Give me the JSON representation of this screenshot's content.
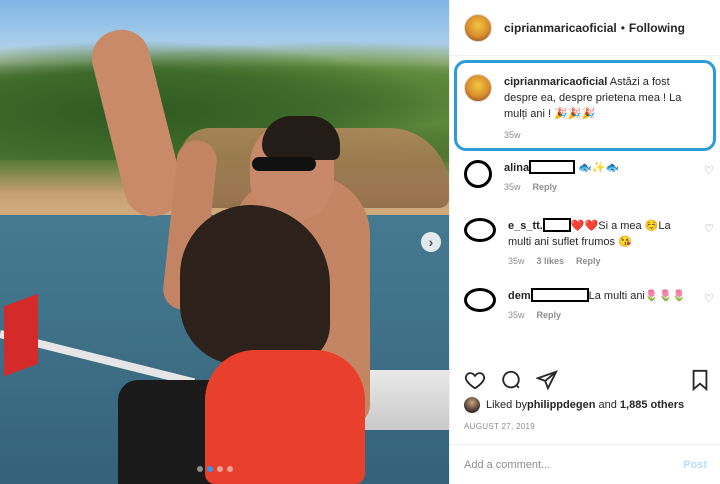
{
  "post": {
    "carousel_next": "›",
    "carousel_dots": 4,
    "active_dot": 1
  },
  "header": {
    "username": "ciprianmaricaoficial",
    "separator": "•",
    "follow_status": "Following"
  },
  "caption": {
    "username": "ciprianmaricaoficial",
    "text": " Astăzi a fost despre ea, despre prietena mea ! La mulți ani ! 🎉🎉🎉",
    "time": "35w"
  },
  "comments": [
    {
      "username": "alina",
      "emojis": "🐟✨🐟",
      "time": "35w",
      "likes": "",
      "reply": "Reply"
    },
    {
      "username": "e_s_tt.",
      "text": "❤️❤️Si a mea ☺️La multi ani suflet frumos 😘",
      "time": "35w",
      "likes": "3 likes",
      "reply": "Reply"
    },
    {
      "username": "dem",
      "text": "La multi ani🌷🌷🌷",
      "time": "35w",
      "likes": "",
      "reply": "Reply"
    }
  ],
  "icons": {
    "like": "heart-icon",
    "comment": "comment-icon",
    "share": "share-icon",
    "save": "bookmark-icon",
    "comment_like": "♡"
  },
  "likes": {
    "prefix": "Liked by ",
    "user": "philippdegen",
    "middle": " and ",
    "count": "1,885 others"
  },
  "date": "AUGUST 27, 2019",
  "add_comment": {
    "placeholder": "Add a comment...",
    "post_label": "Post"
  },
  "colors": {
    "highlight_border": "#2b9bd9",
    "post_button": "#b2dffc",
    "muted_text": "#8e8e8e"
  }
}
